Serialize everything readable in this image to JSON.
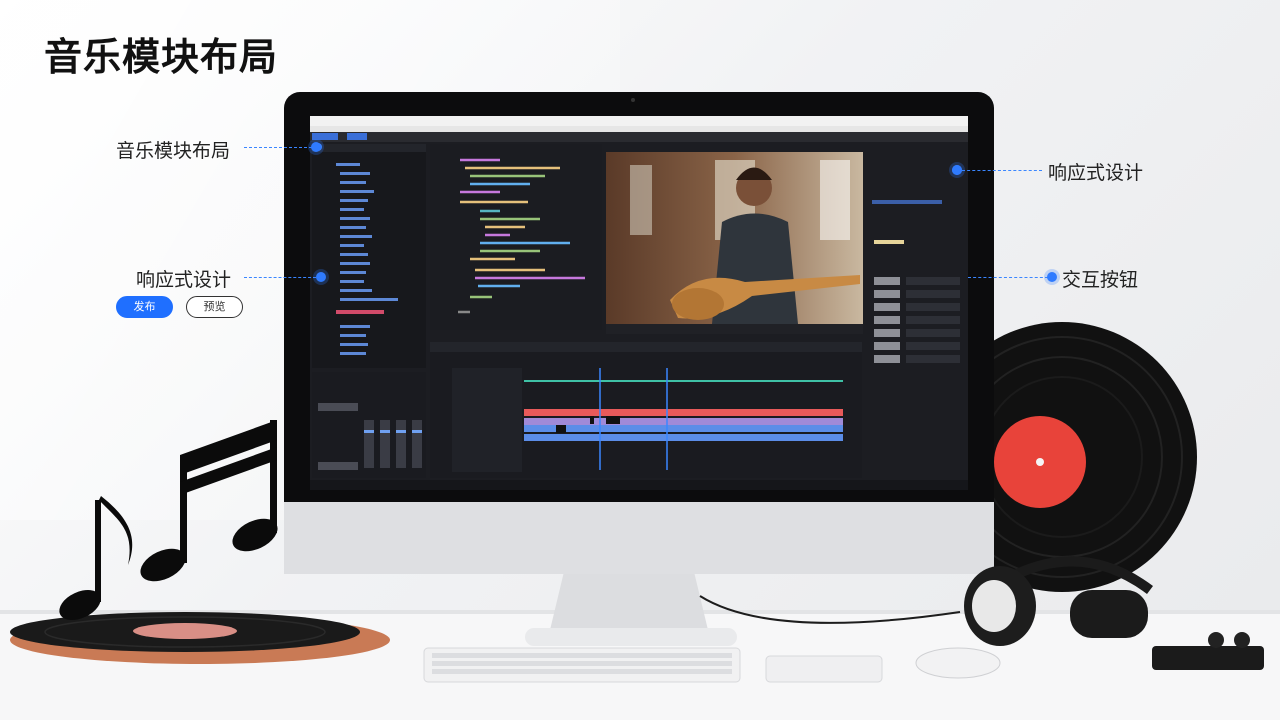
{
  "title": "音乐模块布局",
  "callouts": {
    "left_top": "音乐模块布局",
    "left_mid": "响应式设计",
    "right_top": "响应式设计",
    "right_mid": "交互按钮"
  },
  "buttons": {
    "primary": "发布",
    "secondary": "预览"
  },
  "colors": {
    "accent": "#1f6fff",
    "callout_line": "#3a86ff",
    "track_red": "#e85a5a",
    "track_blue": "#5b8de8",
    "track_teal": "#3fc1a6",
    "vinyl_label": "#e8433a"
  },
  "icons": [
    "musical-notes-icon",
    "vinyl-record-icon",
    "headphones-icon",
    "keyboard-icon",
    "mouse-icon"
  ]
}
